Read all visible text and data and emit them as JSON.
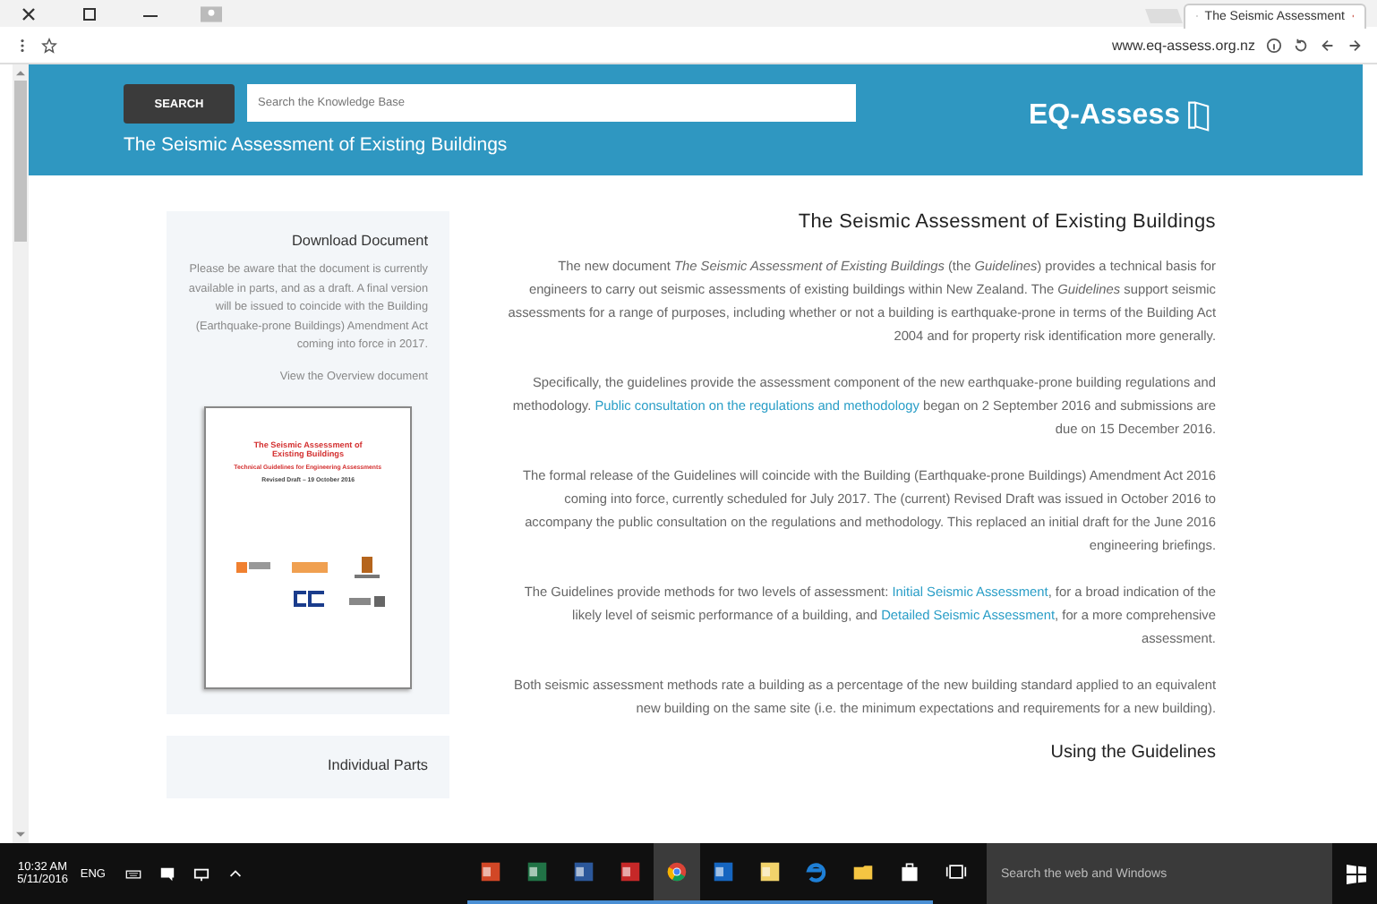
{
  "browser": {
    "tab_title": "The Seismic Assessment",
    "url": "www.eq-assess.org.nz"
  },
  "header": {
    "logo": "EQ-Assess",
    "search": {
      "placeholder": "Search the Knowledge Base"
    },
    "search_button": "SEARCH",
    "subtitle": "The Seismic Assessment of Existing Buildings"
  },
  "main": {
    "title": "The Seismic Assessment of Existing Buildings",
    "paragraphs": [
      [
        {
          "text": "The new document *The Seismic Assessment of Existing Buildings* (the *Guidelines*) provides a technical basis for engineers to carry out seismic assessments of existing buildings within New Zealand. The *Guidelines* support seismic assessments for a range of purposes, including whether or not a building is earthquake-prone in terms of the Building Act 2004 and for property risk identification more generally.",
          "link": false
        }
      ],
      [
        {
          "text": "Specifically, the guidelines provide the assessment component of the new earthquake-prone building regulations and methodology. ",
          "link": false
        },
        {
          "text": "Public consultation on the regulations and methodology",
          "link": true
        },
        {
          "text": " began on 2 September 2016 and submissions are due on 15 December 2016.",
          "link": false
        }
      ],
      [
        {
          "text": "The formal release of the Guidelines will coincide with the Building (Earthquake-prone Buildings) Amendment Act 2016 coming into force, currently scheduled for July 2017. The (current) Revised Draft was issued in October 2016 to accompany the public consultation on the regulations and methodology. This replaced an initial draft for the June 2016 engineering briefings.",
          "link": false
        }
      ],
      [
        {
          "text": "The Guidelines provide methods for two levels of assessment: ",
          "link": false
        },
        {
          "text": "Initial Seismic Assessment",
          "link": true
        },
        {
          "text": ", for a broad indication of the likely level of seismic performance of a building, and ",
          "link": false
        },
        {
          "text": "Detailed Seismic Assessment",
          "link": true
        },
        {
          "text": ", for a more comprehensive assessment.",
          "link": false
        }
      ],
      [
        {
          "text": "Both seismic assessment methods rate a building as a percentage of the new building standard applied to an equivalent new building on the same site (i.e. the minimum expectations and requirements for a new building).",
          "link": false
        }
      ]
    ],
    "subheading": "Using the Guidelines"
  },
  "sidebar": {
    "download": {
      "title": "Download Document",
      "text": "Please be aware that the document is currently available in parts, and as a draft. A final version will be issued to coincide with the Building (Earthquake-prone Buildings) Amendment Act coming into force in 2017.",
      "link": "View the Overview document",
      "cover": {
        "title": "The Seismic Assessment of Existing Buildings",
        "subtitle": "Technical Guidelines for Engineering Assessments",
        "date": "Revised Draft – 19 October 2016"
      }
    },
    "parts_title": "Individual Parts"
  },
  "taskbar": {
    "search": {
      "placeholder": "Search the web and Windows"
    },
    "apps": [
      {
        "kind": "taskview",
        "selected": false
      },
      {
        "kind": "store",
        "selected": false
      },
      {
        "kind": "folder",
        "selected": false
      },
      {
        "kind": "edge",
        "selected": false
      },
      {
        "kind": "notes",
        "selected": false
      },
      {
        "kind": "outlook",
        "selected": false
      },
      {
        "kind": "chrome",
        "selected": true
      },
      {
        "kind": "acrobat",
        "selected": false
      },
      {
        "kind": "word",
        "selected": false
      },
      {
        "kind": "excel",
        "selected": false
      },
      {
        "kind": "powerpoint",
        "selected": false
      }
    ],
    "language": "ENG",
    "time": "10:32 AM",
    "date": "5/11/2016"
  }
}
